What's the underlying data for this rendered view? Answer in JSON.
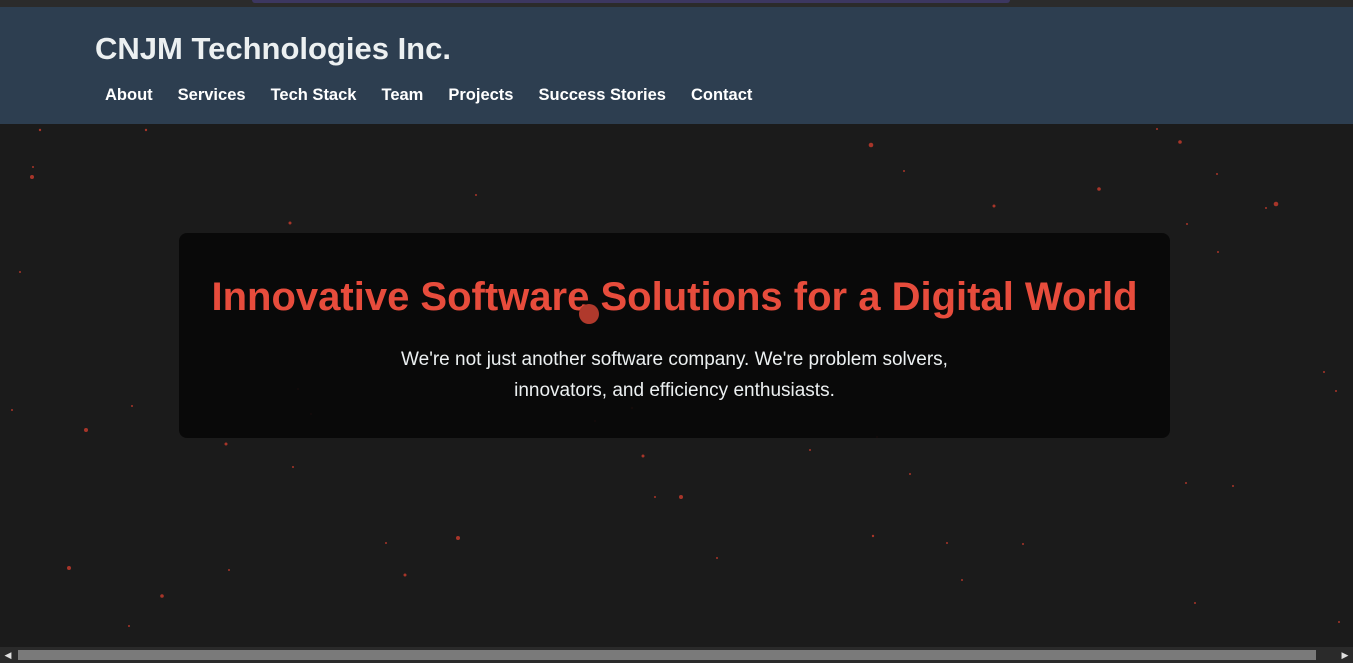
{
  "header": {
    "title": "CNJM Technologies Inc."
  },
  "nav": {
    "items": [
      {
        "label": "About"
      },
      {
        "label": "Services"
      },
      {
        "label": "Tech Stack"
      },
      {
        "label": "Team"
      },
      {
        "label": "Projects"
      },
      {
        "label": "Success Stories"
      },
      {
        "label": "Contact"
      }
    ]
  },
  "hero": {
    "heading": "Innovative Software Solutions for a Digital World",
    "subtext": "We're not just another software company. We're problem solvers, innovators, and efficiency enthusiasts."
  },
  "colors": {
    "header_bg": "#2d3e50",
    "page_bg": "#1b1b1b",
    "accent": "#e74c3c",
    "particle": "#c0392b"
  },
  "scrollbar": {
    "left_arrow_icon": "triangle-left-icon",
    "right_arrow_icon": "triangle-right-icon"
  }
}
